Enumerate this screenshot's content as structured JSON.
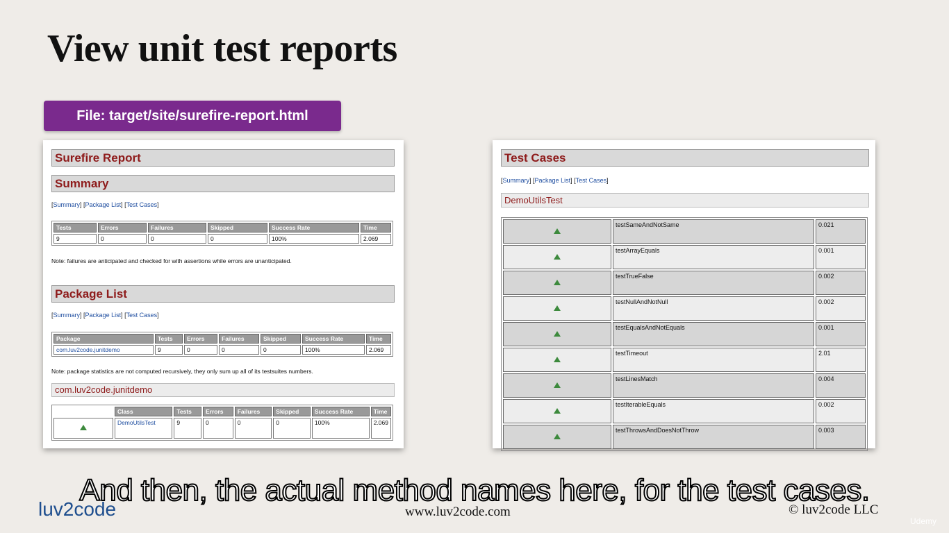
{
  "slide": {
    "title": "View unit test reports",
    "file_label": "File: target/site/surefire-report.html",
    "caption": "And then, the actual method names here, for the test cases.",
    "logo": "luv2code",
    "website": "www.luv2code.com",
    "copyright": "© luv2code LLC",
    "udemy": "Udemy"
  },
  "left_report": {
    "surefire_title": "Surefire Report",
    "summary_title": "Summary",
    "nav": {
      "summary": "Summary",
      "package_list": "Package List",
      "test_cases": "Test Cases"
    },
    "summary_headers": [
      "Tests",
      "Errors",
      "Failures",
      "Skipped",
      "Success Rate",
      "Time"
    ],
    "summary_values": [
      "9",
      "0",
      "0",
      "0",
      "100%",
      "2.069"
    ],
    "summary_note": "Note: failures are anticipated and checked for with assertions while errors are unanticipated.",
    "package_list_title": "Package List",
    "package_headers": [
      "Package",
      "Tests",
      "Errors",
      "Failures",
      "Skipped",
      "Success Rate",
      "Time"
    ],
    "package_values": [
      "com.luv2code.junitdemo",
      "9",
      "0",
      "0",
      "0",
      "100%",
      "2.069"
    ],
    "package_note": "Note: package statistics are not computed recursively, they only sum up all of its testsuites numbers.",
    "package_name": "com.luv2code.junitdemo",
    "class_headers": [
      "",
      "Class",
      "Tests",
      "Errors",
      "Failures",
      "Skipped",
      "Success Rate",
      "Time"
    ],
    "class_values": [
      "",
      "DemoUtilsTest",
      "9",
      "0",
      "0",
      "0",
      "100%",
      "2.069"
    ]
  },
  "right_report": {
    "title": "Test Cases",
    "nav": {
      "summary": "Summary",
      "package_list": "Package List",
      "test_cases": "Test Cases"
    },
    "class_name": "DemoUtilsTest",
    "cases": [
      {
        "name": "testSameAndNotSame",
        "time": "0.021"
      },
      {
        "name": "testArrayEquals",
        "time": "0.001"
      },
      {
        "name": "testTrueFalse",
        "time": "0.002"
      },
      {
        "name": "testNullAndNotNull",
        "time": "0.002"
      },
      {
        "name": "testEqualsAndNotEquals",
        "time": "0.001"
      },
      {
        "name": "testTimeout",
        "time": "2.01"
      },
      {
        "name": "testLinesMatch",
        "time": "0.004"
      },
      {
        "name": "testIterableEquals",
        "time": "0.002"
      },
      {
        "name": "testThrowsAndDoesNotThrow",
        "time": "0.003"
      }
    ]
  }
}
